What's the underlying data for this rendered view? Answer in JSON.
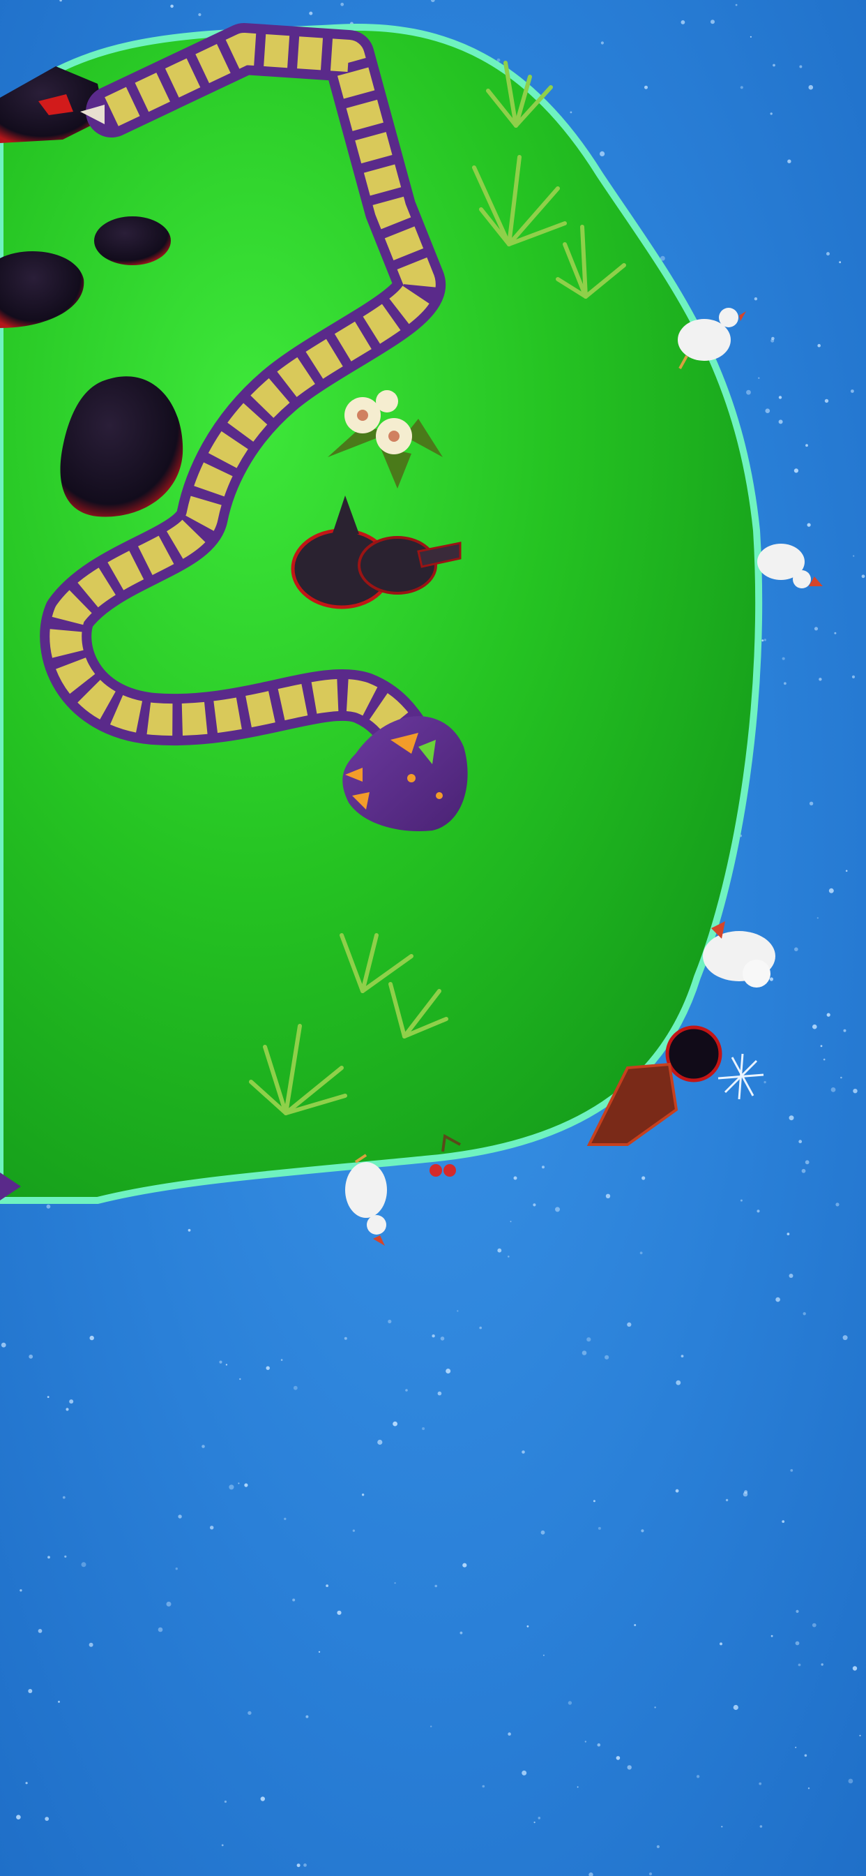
{
  "game": {
    "scene": "planet-snake",
    "colors": {
      "sky": "#2a80d8",
      "planet": "#22c51f",
      "planet_rim": "#5ff0b0",
      "snake_body": "#5a2a8a",
      "snake_scale": "#d9c95a",
      "rock": "#1a1426",
      "rock_glow": "#c81a1a",
      "chicken": "#f2f2f2",
      "grass": "#7cc43a"
    },
    "icons": {
      "snake": "snake-icon",
      "chicken": "chicken-icon",
      "rabbit": "rabbit-icon",
      "flower": "flower-icon",
      "grass": "grass-icon",
      "rock": "rock-icon",
      "cherry": "cherry-icon",
      "sparkle": "sparkle-icon"
    }
  }
}
